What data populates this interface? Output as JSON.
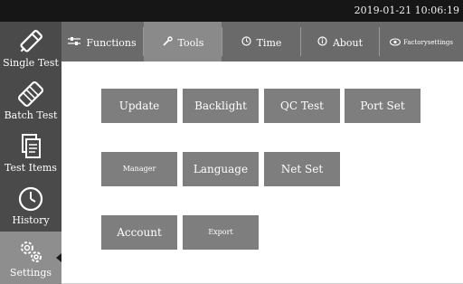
{
  "status_bar": {
    "datetime": "2019-01-21 10:06:19"
  },
  "sidebar": {
    "items": [
      {
        "label": "Single Test",
        "icon": "syringe-icon"
      },
      {
        "label": "Batch Test",
        "icon": "test-strip-icon"
      },
      {
        "label": "Test Items",
        "icon": "documents-icon"
      },
      {
        "label": "History",
        "icon": "clock-icon"
      },
      {
        "label": "Settings",
        "icon": "gears-icon"
      }
    ],
    "active": "Settings"
  },
  "tabs": [
    {
      "label": "Functions",
      "icon": "sliders-icon"
    },
    {
      "label": "Tools",
      "icon": "wrench-icon"
    },
    {
      "label": "Time",
      "icon": "clock-icon"
    },
    {
      "label": "About",
      "icon": "info-icon"
    },
    {
      "label": "Factorysettings",
      "icon": "eye-icon"
    }
  ],
  "active_tab": "Tools",
  "buttons": [
    {
      "label": "Update"
    },
    {
      "label": "Backlight"
    },
    {
      "label": "QC Test"
    },
    {
      "label": "Port Set"
    },
    {
      "label": "Manager"
    },
    {
      "label": "Language"
    },
    {
      "label": "Net Set"
    },
    {
      "label": "Account"
    },
    {
      "label": "Export"
    }
  ],
  "colors": {
    "status_bar": "#161616",
    "sidebar": "#4a4a4a",
    "sidebar_active": "#8e8e8e",
    "tab_bar": "#6a6a6a",
    "tab_active": "#8a8a8a",
    "button": "#7e7e7e",
    "text_light": "#ffffff"
  }
}
